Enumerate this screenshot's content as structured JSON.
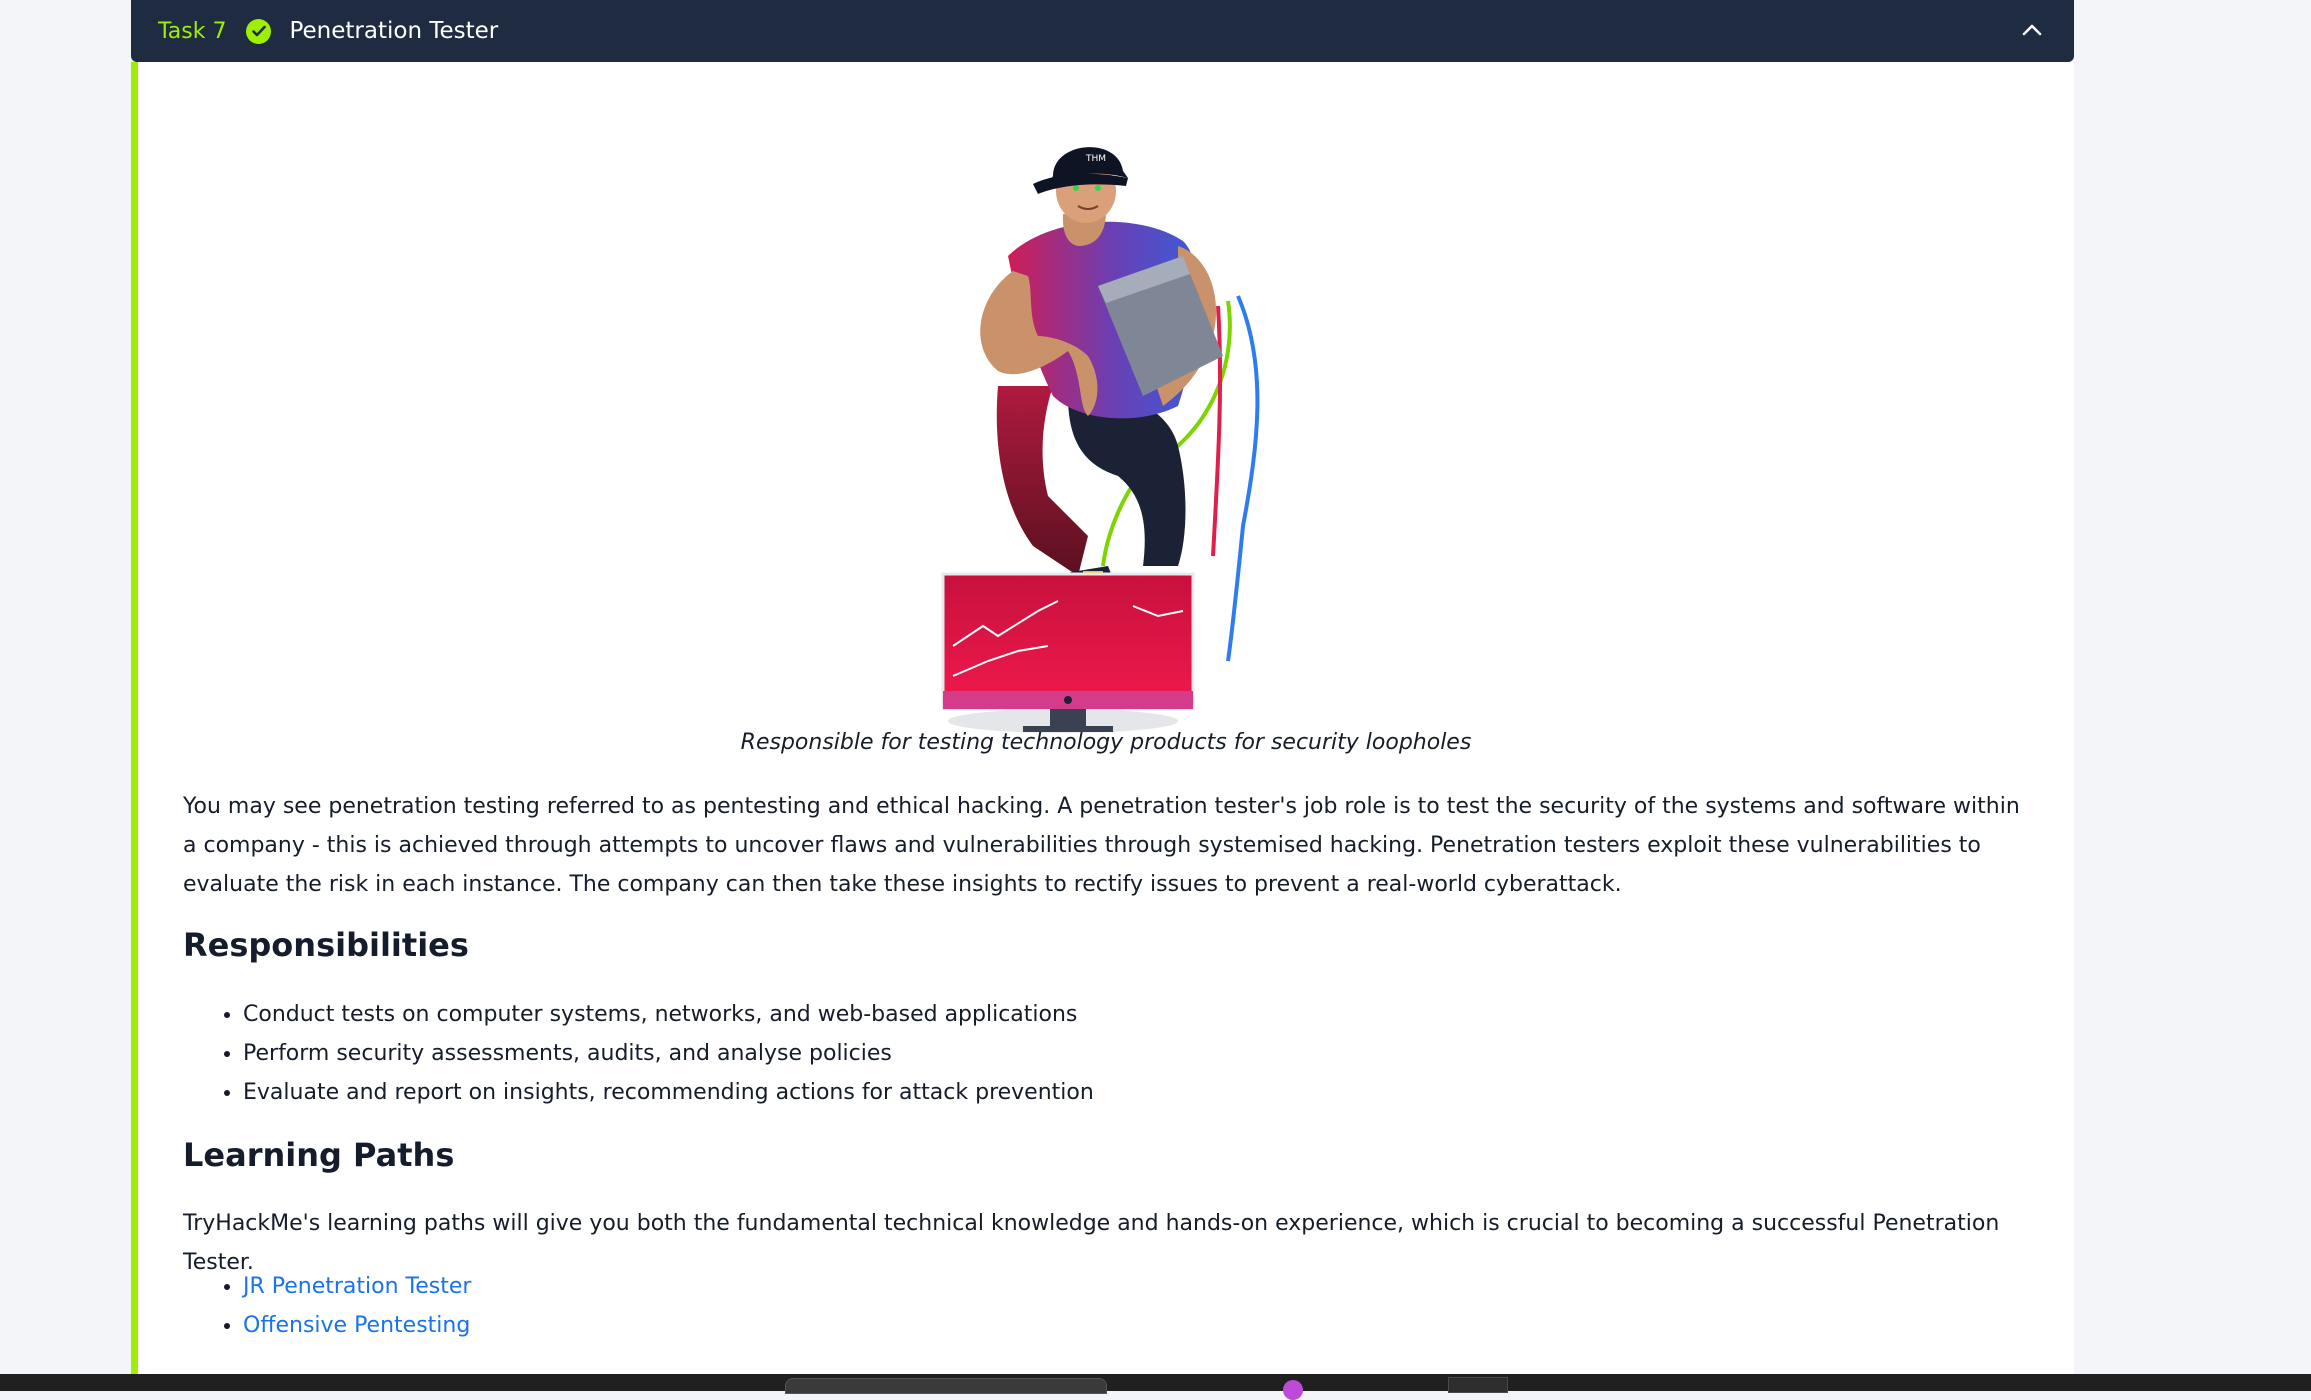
{
  "task": {
    "number_label": "Task 7",
    "title": "Penetration Tester"
  },
  "content": {
    "caption": "Responsible for testing technology products for security loopholes",
    "intro": "You may see penetration testing referred to as pentesting and ethical hacking. A penetration tester's job role is to test the security of the systems and software within a company - this is achieved through attempts to uncover flaws and vulnerabilities through systemised hacking. Penetration testers exploit these vulnerabilities to evaluate the risk in each instance. The company can then take these insights to rectify issues to prevent a real-world cyberattack.",
    "responsibilities_heading": "Responsibilities",
    "responsibilities": [
      "Conduct tests on computer systems, networks, and web-based applications",
      "Perform security assessments, audits, and analyse policies",
      "Evaluate and report on insights, recommending actions for attack prevention"
    ],
    "paths_heading": "Learning Paths",
    "paths_intro": "TryHackMe's learning paths will give you both the fundamental technical knowledge and hands-on experience, which is crucial to becoming a successful Penetration Tester.",
    "paths": [
      "JR Penetration Tester",
      "Offensive Pentesting"
    ]
  },
  "colors": {
    "header_bg": "#1f2b40",
    "accent_green": "#9fef00",
    "link_blue": "#1a73e8",
    "text_dark": "#151c2b"
  },
  "icons": [
    "check-circle-icon",
    "chevron-up-icon"
  ]
}
